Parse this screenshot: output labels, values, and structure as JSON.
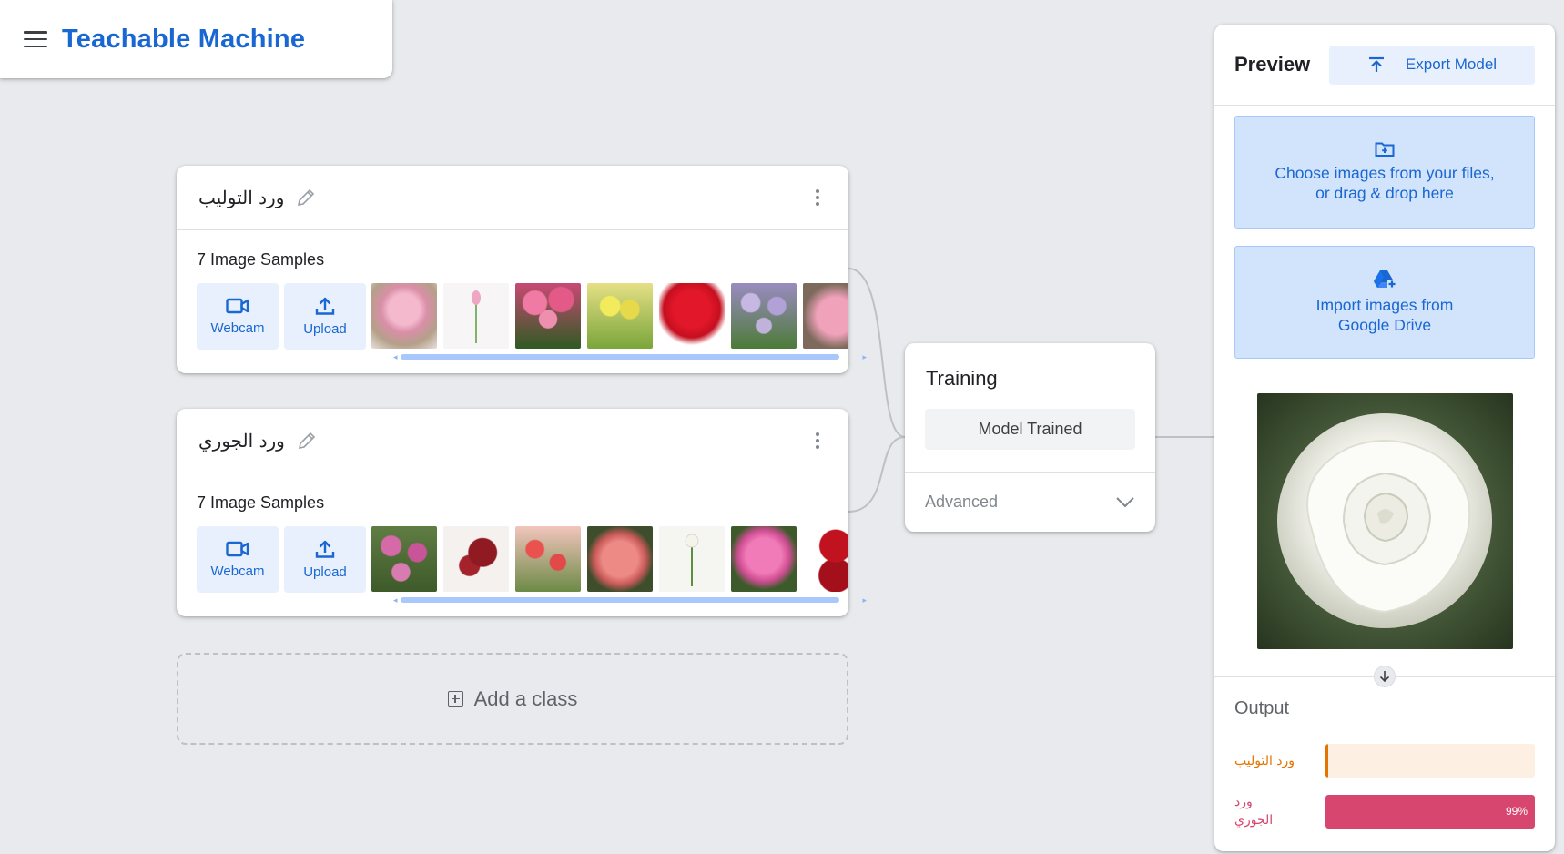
{
  "app": {
    "title": "Teachable Machine",
    "menu_icon": "hamburger-icon"
  },
  "classes": [
    {
      "name": "ورد التوليب",
      "samples_label": "7 Image Samples",
      "webcam_label": "Webcam",
      "upload_label": "Upload",
      "thumb_colors": [
        "#e9a6bf",
        "#f4f0f2",
        "#d84f7d",
        "#d8d24a",
        "#d61c2a",
        "#a899c9",
        "#de8aa4"
      ]
    },
    {
      "name": "ورد الجوري",
      "samples_label": "7 Image Samples",
      "webcam_label": "Webcam",
      "upload_label": "Upload",
      "thumb_colors": [
        "#c2569b",
        "#8f1a22",
        "#e24a4a",
        "#e27a78",
        "#f1f4ee",
        "#e767a9",
        "#b0101d"
      ]
    }
  ],
  "add_class_label": "Add a class",
  "training": {
    "title": "Training",
    "button_label": "Model Trained",
    "advanced_label": "Advanced"
  },
  "preview": {
    "title": "Preview",
    "export_label": "Export Model",
    "choose_files_line1": "Choose images from your files,",
    "choose_files_line2": "or drag & drop here",
    "drive_line1": "Import images from",
    "drive_line2": "Google Drive",
    "output_title": "Output",
    "outputs": [
      {
        "label": "ورد التوليب",
        "confidence": 0.01,
        "percent_text": "",
        "color": "#e37400",
        "track_color": "#feefe3"
      },
      {
        "label_line1": "ورد",
        "label_line2": "الجوري",
        "confidence": 0.99,
        "percent_text": "99%",
        "color": "#d6466e",
        "track_color": "#fce8ef"
      }
    ]
  },
  "colors": {
    "accent": "#1967d2",
    "button_bg": "#e8f0fe",
    "page_bg": "#e8eaed"
  }
}
